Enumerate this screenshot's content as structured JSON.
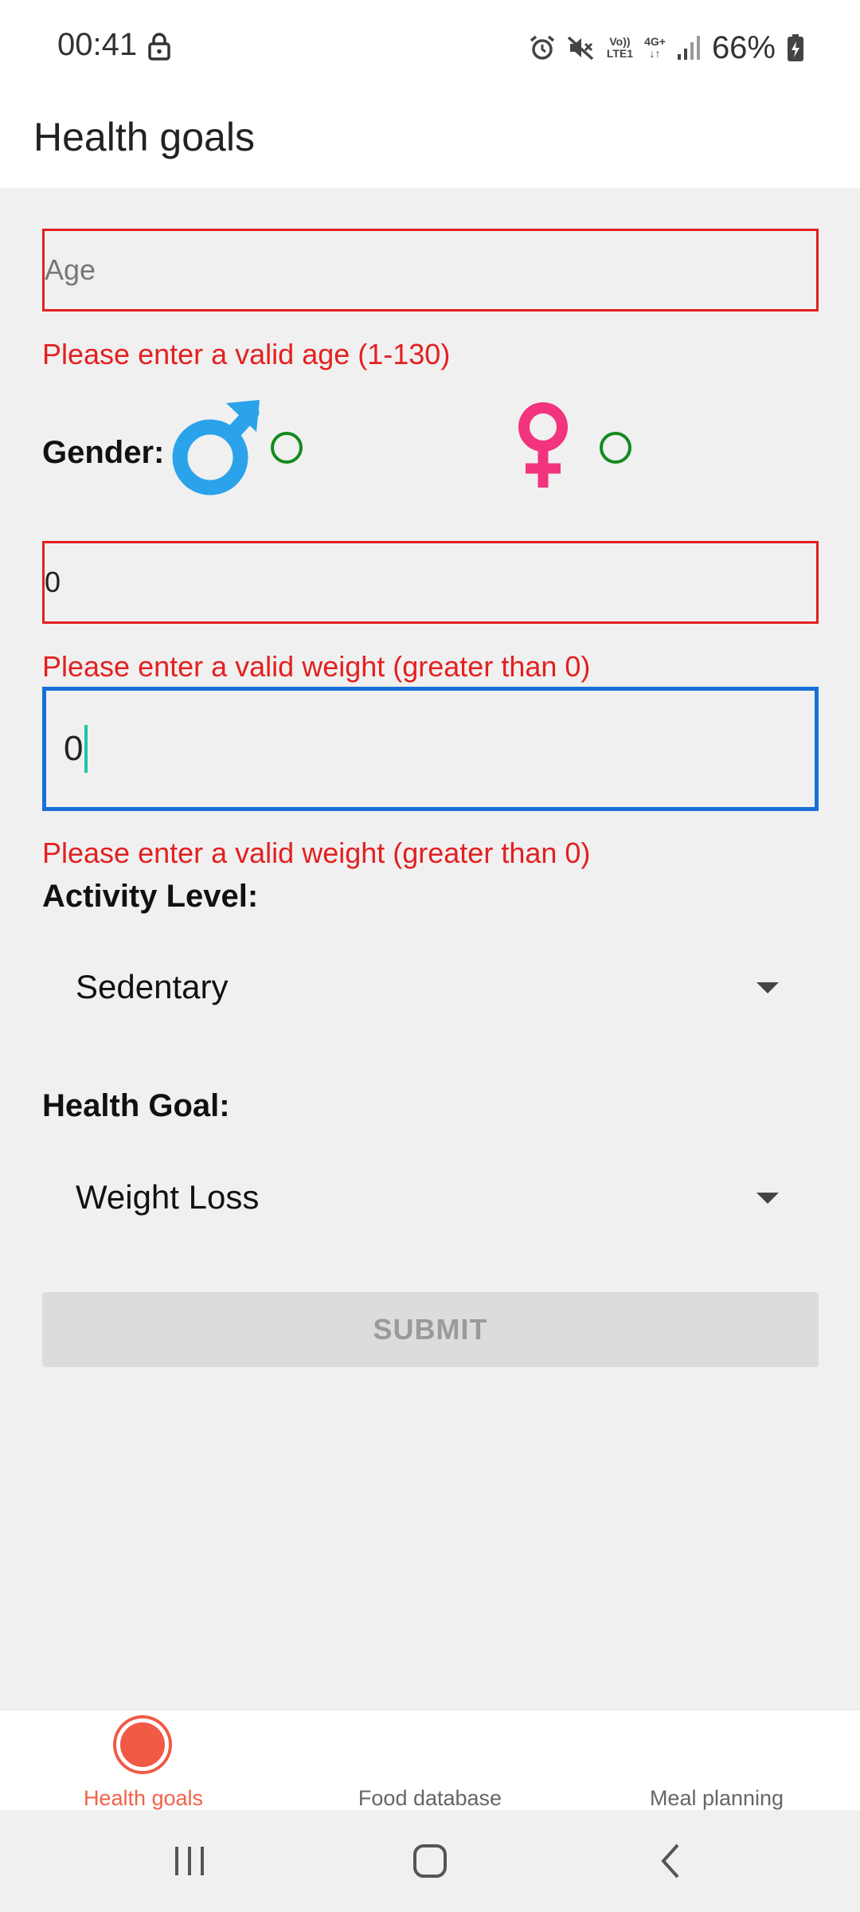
{
  "status_bar": {
    "time": "00:41",
    "lock_icon": "lock-icon",
    "icons": [
      "alarm-icon",
      "mute-icon",
      "volte-icon",
      "network-4g-icon",
      "signal-icon"
    ],
    "volte_line1": "Vo))",
    "volte_line2": "LTE1",
    "network_line1": "4G+",
    "network_line2": "↓↑",
    "battery_percent": "66%",
    "battery_icon": "battery-charging-icon"
  },
  "app_bar": {
    "title": "Health goals"
  },
  "form": {
    "age": {
      "value": "",
      "placeholder": "Age",
      "error": "Please enter a valid age (1-130)"
    },
    "gender": {
      "label": "Gender:",
      "male_icon": "male-symbol-icon",
      "female_icon": "female-symbol-icon",
      "male_color": "#2aa3ea",
      "female_color": "#f2347c"
    },
    "weight": {
      "value": "0",
      "error": "Please enter a valid weight (greater than 0)"
    },
    "height": {
      "value": "0",
      "error": "Please enter a valid weight (greater than 0)"
    },
    "activity": {
      "label": "Activity Level:",
      "selected": "Sedentary"
    },
    "goal": {
      "label": "Health Goal:",
      "selected": "Weight Loss"
    },
    "submit_label": "SUBMIT"
  },
  "bottom_nav": {
    "items": [
      {
        "label": "Health goals",
        "active": true
      },
      {
        "label": "Food database",
        "active": false
      },
      {
        "label": "Meal planning",
        "active": false
      }
    ],
    "accent": "#f15a45"
  },
  "system_nav": {
    "icons": [
      "recents-icon",
      "home-icon",
      "back-icon"
    ]
  },
  "colors": {
    "error": "#e32020",
    "focus": "#1a6fd8",
    "radio": "#138a1d",
    "cursor": "#1fc4a8"
  }
}
